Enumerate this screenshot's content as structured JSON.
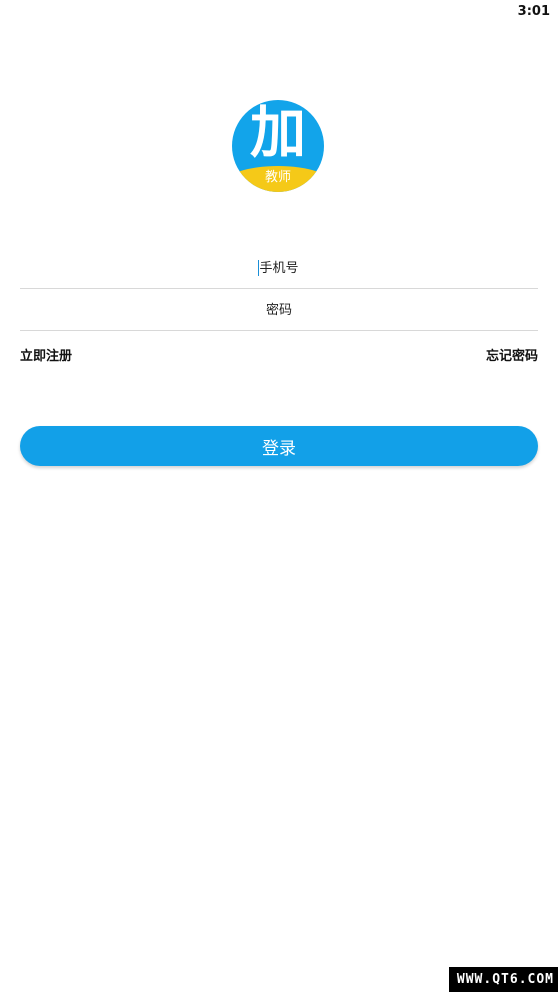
{
  "status_bar": {
    "time": "3:01"
  },
  "logo": {
    "main_char": "加",
    "sub_text": "教师",
    "bg_color": "#12a4ea",
    "band_color": "#f5c918"
  },
  "form": {
    "phone_placeholder": "手机号",
    "password_placeholder": "密码"
  },
  "links": {
    "register": "立即注册",
    "forgot": "忘记密码"
  },
  "login_button": {
    "label": "登录",
    "color": "#12a0e8"
  },
  "watermark": "WWW.QT6.COM"
}
